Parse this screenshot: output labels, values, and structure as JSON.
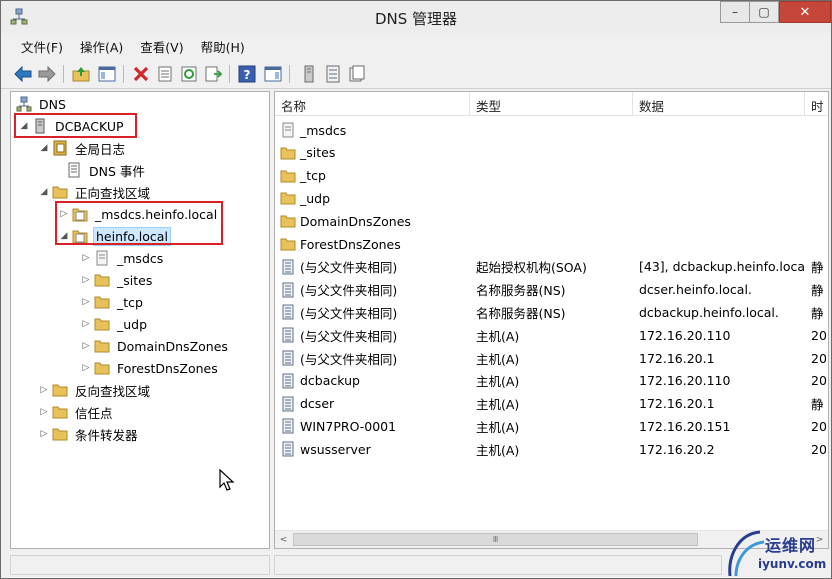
{
  "window": {
    "title": "DNS 管理器",
    "close_glyph": "✕",
    "max_glyph": "▢",
    "min_glyph": "–"
  },
  "menu": [
    "文件(F)",
    "操作(A)",
    "查看(V)",
    "帮助(H)"
  ],
  "toolbar_icons": [
    "back-arrow-icon",
    "forward-arrow-icon",
    "up-folder-icon",
    "show-hide-tree-icon",
    "delete-icon",
    "properties-icon",
    "refresh-icon",
    "export-list-icon",
    "help-icon",
    "show-action-pane-icon",
    "server-icon",
    "record-list-icon",
    "new-zone-icon"
  ],
  "tree": {
    "root": "DNS",
    "server": "DCBACKUP",
    "global_logs": "全局日志",
    "dns_events": "DNS 事件",
    "forward_zones": "正向查找区域",
    "zone_msdcs": "_msdcs.heinfo.local",
    "zone_heinfo": "heinfo.local",
    "sub_msdcs": "_msdcs",
    "sub_sites": "_sites",
    "sub_tcp": "_tcp",
    "sub_udp": "_udp",
    "sub_domaindns": "DomainDnsZones",
    "sub_forestdns": "ForestDnsZones",
    "reverse_zones": "反向查找区域",
    "trust_points": "信任点",
    "conditional_forwarders": "条件转发器"
  },
  "columns": {
    "name": "名称",
    "type": "类型",
    "data": "数据",
    "time": "时"
  },
  "records": [
    {
      "name": "_msdcs",
      "type": "",
      "data": "",
      "time": "",
      "kind": "folder-msdcs"
    },
    {
      "name": "_sites",
      "type": "",
      "data": "",
      "time": "",
      "kind": "folder"
    },
    {
      "name": "_tcp",
      "type": "",
      "data": "",
      "time": "",
      "kind": "folder"
    },
    {
      "name": "_udp",
      "type": "",
      "data": "",
      "time": "",
      "kind": "folder"
    },
    {
      "name": "DomainDnsZones",
      "type": "",
      "data": "",
      "time": "",
      "kind": "folder"
    },
    {
      "name": "ForestDnsZones",
      "type": "",
      "data": "",
      "time": "",
      "kind": "folder"
    },
    {
      "name": "(与父文件夹相同)",
      "type": "起始授权机构(SOA)",
      "data": "[43], dcbackup.heinfo.local.",
      "time": "静",
      "kind": "record"
    },
    {
      "name": "(与父文件夹相同)",
      "type": "名称服务器(NS)",
      "data": "dcser.heinfo.local.",
      "time": "静",
      "kind": "record"
    },
    {
      "name": "(与父文件夹相同)",
      "type": "名称服务器(NS)",
      "data": "dcbackup.heinfo.local.",
      "time": "静",
      "kind": "record"
    },
    {
      "name": "(与父文件夹相同)",
      "type": "主机(A)",
      "data": "172.16.20.110",
      "time": "20",
      "kind": "record"
    },
    {
      "name": "(与父文件夹相同)",
      "type": "主机(A)",
      "data": "172.16.20.1",
      "time": "20",
      "kind": "record"
    },
    {
      "name": "dcbackup",
      "type": "主机(A)",
      "data": "172.16.20.110",
      "time": "20",
      "kind": "record"
    },
    {
      "name": "dcser",
      "type": "主机(A)",
      "data": "172.16.20.1",
      "time": "静",
      "kind": "record"
    },
    {
      "name": "WIN7PRO-0001",
      "type": "主机(A)",
      "data": "172.16.20.151",
      "time": "20",
      "kind": "record"
    },
    {
      "name": "wsusserver",
      "type": "主机(A)",
      "data": "172.16.20.2",
      "time": "20",
      "kind": "record"
    }
  ],
  "scrollbar": {
    "left": "<",
    "right": ">",
    "grip": "Ⅲ"
  },
  "watermark": {
    "line1": "运维网",
    "line2": "iyunv.com"
  },
  "colors": {
    "highlight_box": "#d9212a",
    "selection": "#cde8ff",
    "folder": "#e9c15a"
  }
}
